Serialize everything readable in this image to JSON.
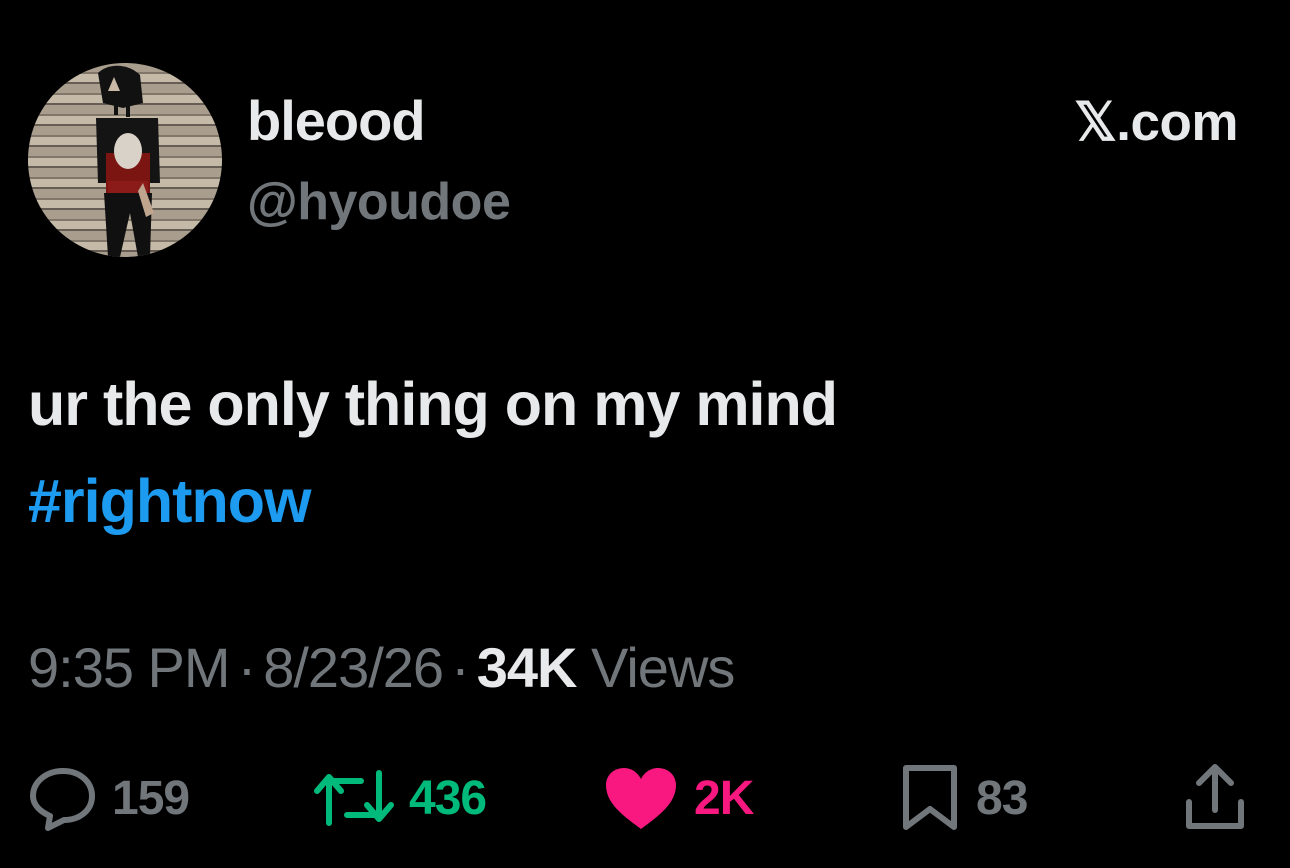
{
  "author": {
    "display_name": "bleood",
    "handle": "@hyoudoe"
  },
  "brand": "𝕏.com",
  "tweet": {
    "text": "ur the only thing on my mind",
    "hashtag": "#rightnow"
  },
  "meta": {
    "time": "9:35 PM",
    "date": "8/23/26",
    "views_count": "34K",
    "views_label": "Views",
    "separator": "·"
  },
  "actions": {
    "replies": "159",
    "reposts": "436",
    "likes": "2K",
    "bookmarks": "83"
  },
  "colors": {
    "background": "#000000",
    "text_primary": "#e7e9ea",
    "text_secondary": "#71767b",
    "hashtag": "#1d9bf0",
    "repost": "#00ba7c",
    "like": "#f91880"
  },
  "icons": [
    "reply-icon",
    "repost-icon",
    "like-icon",
    "bookmark-icon",
    "share-icon"
  ]
}
